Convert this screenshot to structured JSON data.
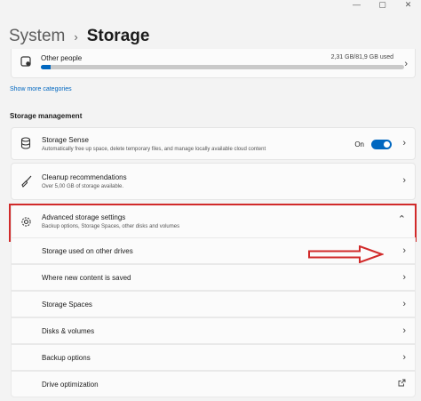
{
  "window_controls": {
    "minimize": "—",
    "maximize": "▢",
    "close": "✕"
  },
  "header": {
    "breadcrumb": "System",
    "separator": "›",
    "current": "Storage"
  },
  "other_people": {
    "label": "Other people",
    "usage": "2,31 GB/81,9 GB used",
    "progress_fraction": 0.028,
    "icon": "people-icon"
  },
  "show_more": "Show more categories",
  "section_title": "Storage management",
  "storage_sense": {
    "title": "Storage Sense",
    "desc": "Automatically free up space, delete temporary files, and manage locally available cloud content",
    "state_label": "On",
    "enabled": true,
    "icon": "database-icon"
  },
  "cleanup": {
    "title": "Cleanup recommendations",
    "desc": "Over 5,00 GB of storage available.",
    "icon": "broom-icon"
  },
  "advanced": {
    "title": "Advanced storage settings",
    "desc": "Backup options, Storage Spaces, other disks and volumes",
    "icon": "gear-icon",
    "expanded": true
  },
  "sub_items": [
    {
      "label": "Storage used on other drives"
    },
    {
      "label": "Where new content is saved"
    },
    {
      "label": "Storage Spaces"
    },
    {
      "label": "Disks & volumes"
    },
    {
      "label": "Backup options"
    },
    {
      "label": "Drive optimization"
    }
  ],
  "colors": {
    "accent": "#0067c0",
    "highlight_box": "#d12a2a",
    "background": "#f3f3f3"
  }
}
